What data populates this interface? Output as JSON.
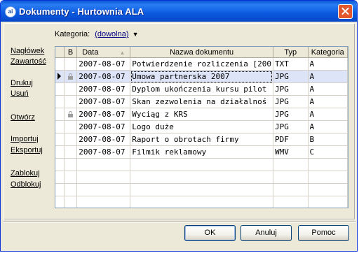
{
  "window": {
    "title": "Dokumenty - Hurtownia ALA",
    "app_icon": "ai"
  },
  "filter": {
    "label": "Kategoria:",
    "value": "(dowolna)"
  },
  "sidebar": {
    "items": [
      {
        "label": "Nagłówek"
      },
      {
        "label": "Zawartość"
      },
      {
        "label": "Drukuj"
      },
      {
        "label": "Usuń"
      },
      {
        "label": "Otwórz"
      },
      {
        "label": "Importuj"
      },
      {
        "label": "Eksportuj"
      },
      {
        "label": "Zablokuj"
      },
      {
        "label": "Odblokuj"
      }
    ]
  },
  "table": {
    "columns": [
      "",
      "B",
      "Data",
      "Nazwa dokumentu",
      "Typ",
      "Kategoria"
    ],
    "rows": [
      {
        "locked": false,
        "date": "2007-08-07",
        "name": "Potwierdzenie rozliczenia [200",
        "type": "TXT",
        "category": "A"
      },
      {
        "locked": true,
        "date": "2007-08-07",
        "name": "Umowa partnerska 2007",
        "type": "JPG",
        "category": "A",
        "selected": true
      },
      {
        "locked": false,
        "date": "2007-08-07",
        "name": "Dyplom ukończenia kursu pilot",
        "type": "JPG",
        "category": "A"
      },
      {
        "locked": false,
        "date": "2007-08-07",
        "name": "Skan zezwolenia na działalnoś",
        "type": "JPG",
        "category": "A"
      },
      {
        "locked": true,
        "date": "2007-08-07",
        "name": "Wyciąg z KRS",
        "type": "JPG",
        "category": "A"
      },
      {
        "locked": false,
        "date": "2007-08-07",
        "name": "Logo duże",
        "type": "JPG",
        "category": "A"
      },
      {
        "locked": false,
        "date": "2007-08-07",
        "name": "Raport o obrotach firmy",
        "type": "PDF",
        "category": "B"
      },
      {
        "locked": false,
        "date": "2007-08-07",
        "name": "Filmik reklamowy",
        "type": "WMV",
        "category": "C"
      }
    ],
    "empty_rows": 4
  },
  "buttons": {
    "ok": "OK",
    "cancel": "Anuluj",
    "help": "Pomoc"
  },
  "colors": {
    "title_bar": "#0a5ad6",
    "selected_row": "#dde4f7",
    "link": "#000080"
  }
}
